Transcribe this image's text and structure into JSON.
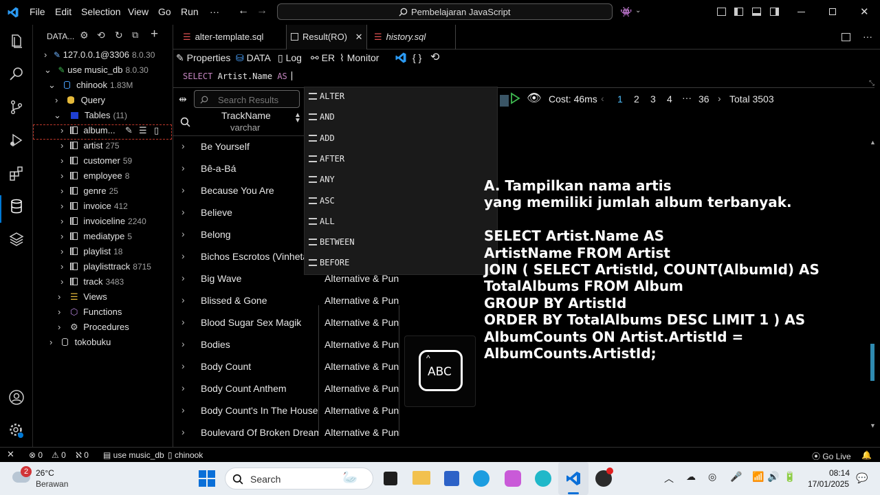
{
  "titlebar": {
    "menus": [
      "File",
      "Edit",
      "Selection",
      "View",
      "Go",
      "Run",
      "···"
    ],
    "search_text": "Pembelajaran JavaScript"
  },
  "sidebar": {
    "title": "DATA...",
    "connection": {
      "label": "127.0.0.1@3306",
      "version": "8.0.30"
    },
    "database": {
      "label": "use music_db",
      "version": "8.0.30"
    },
    "schema": {
      "label": "chinook",
      "size": "1.83M"
    },
    "query_label": "Query",
    "tables_label": "Tables",
    "tables_count": "(11)",
    "tables": [
      {
        "name": "album...",
        "count": ""
      },
      {
        "name": "artist",
        "count": "275"
      },
      {
        "name": "customer",
        "count": "59"
      },
      {
        "name": "employee",
        "count": "8"
      },
      {
        "name": "genre",
        "count": "25"
      },
      {
        "name": "invoice",
        "count": "412"
      },
      {
        "name": "invoiceline",
        "count": "2240"
      },
      {
        "name": "mediatype",
        "count": "5"
      },
      {
        "name": "playlist",
        "count": "18"
      },
      {
        "name": "playlisttrack",
        "count": "8715"
      },
      {
        "name": "track",
        "count": "3483"
      }
    ],
    "views_label": "Views",
    "functions_label": "Functions",
    "procedures_label": "Procedures",
    "other_db": "tokobuku"
  },
  "tabs": [
    {
      "label": "alter-template.sql"
    },
    {
      "label": "Result(RO)"
    },
    {
      "label": "history.sql"
    }
  ],
  "toolbar": {
    "properties": "Properties",
    "data": "DATA",
    "log": "Log",
    "er": "ER",
    "monitor": "Monitor",
    "braces": "{ }"
  },
  "editor": {
    "sql_kw1": "SELECT",
    "sql_mid": "Artist.Name",
    "sql_kw2": "AS"
  },
  "results": {
    "search_placeholder": "Search Results",
    "column_name": "TrackName",
    "column_type": "varchar",
    "cost": "Cost: 46ms",
    "pages": [
      "1",
      "2",
      "3",
      "4",
      "···",
      "36"
    ],
    "total": "Total 3503",
    "rows": [
      {
        "track": "Be Yourself",
        "genre": ""
      },
      {
        "track": "Bê-a-Bá",
        "genre": ""
      },
      {
        "track": "Because You Are",
        "genre": ""
      },
      {
        "track": "Believe",
        "genre": ""
      },
      {
        "track": "Belong",
        "genre": ""
      },
      {
        "track": "Bichos Escrotos (Vinheta)",
        "genre": ""
      },
      {
        "track": "Big Wave",
        "genre": "Alternative & Punk"
      },
      {
        "track": "Blissed & Gone",
        "genre": "Alternative & Punk"
      },
      {
        "track": "Blood Sugar Sex Magik",
        "genre": "Alternative & Punk"
      },
      {
        "track": "Bodies",
        "genre": "Alternative & Punk"
      },
      {
        "track": "Body Count",
        "genre": "Alternative & Punk"
      },
      {
        "track": "Body Count Anthem",
        "genre": "Alternative & Punk"
      },
      {
        "track": "Body Count's In The House",
        "genre": "Alternative & Punk"
      },
      {
        "track": "Boulevard Of Broken Dreams",
        "genre": "Alternative & Punk"
      }
    ]
  },
  "suggestions": [
    "ALTER",
    "AND",
    "ADD",
    "AFTER",
    "ANY",
    "ASC",
    "ALL",
    "BETWEEN",
    "BEFORE"
  ],
  "overlay": {
    "lines": [
      "A. Tampilkan nama artis",
      "yang memiliki jumlah album terbanyak.",
      "",
      "SELECT Artist.Name AS",
      "ArtistName FROM Artist",
      "JOIN ( SELECT ArtistId, COUNT(AlbumId) AS",
      "TotalAlbums FROM Album",
      "GROUP BY ArtistId",
      "ORDER BY TotalAlbums DESC LIMIT 1 ) AS",
      "AlbumCounts ON Artist.ArtistId =",
      "AlbumCounts.ArtistId;"
    ],
    "abc_label": "ABC"
  },
  "statusbar": {
    "errors": "0",
    "warnings": "0",
    "problems": "0",
    "db": "use music_db",
    "schema": "chinook",
    "golive": "Go Live"
  },
  "taskbar": {
    "weather_badge": "2",
    "temp": "26°C",
    "condition": "Berawan",
    "search": "Search",
    "time": "08:14",
    "date": "17/01/2025"
  },
  "colors": {
    "accent": "#0078d4",
    "keyword": "#c586c0",
    "run_green": "#3fb950",
    "db_icon": "#4aa3ff",
    "tab_icon_red": "#e05252"
  }
}
